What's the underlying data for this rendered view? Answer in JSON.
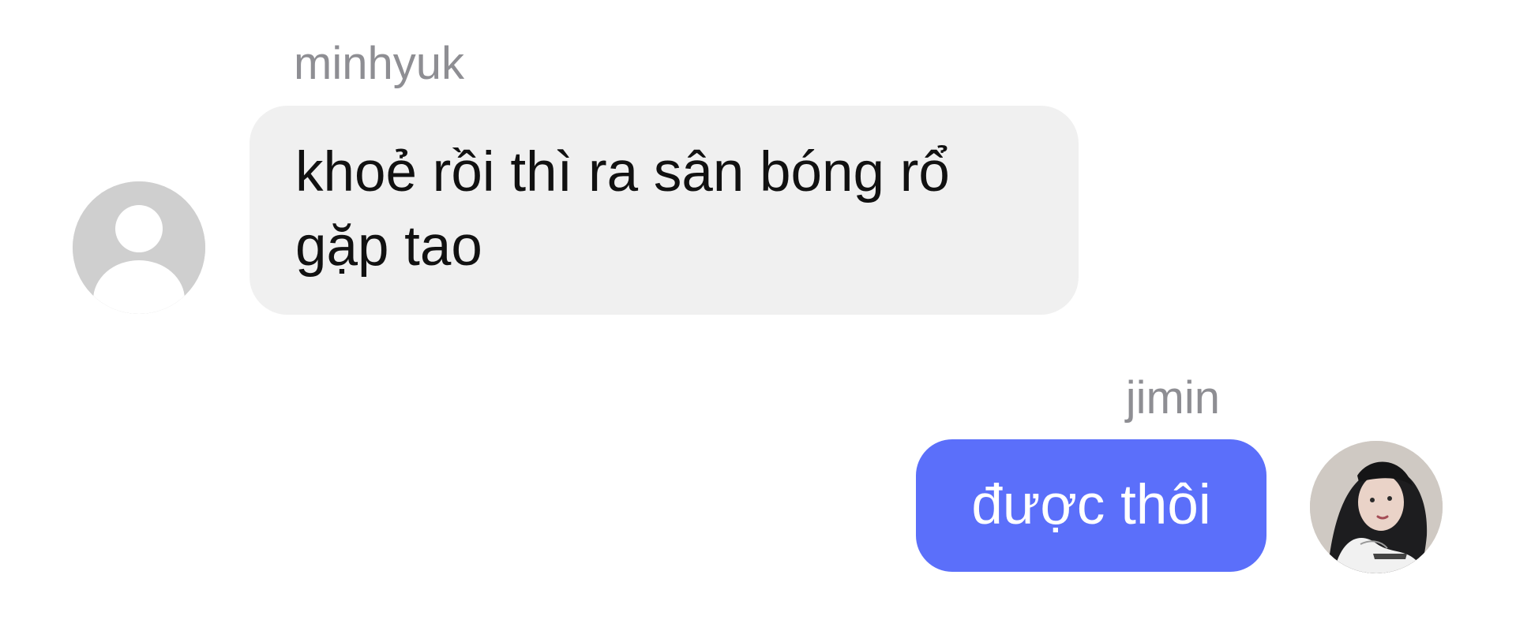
{
  "messages": [
    {
      "sender": "minhyuk",
      "text": "khoẻ rồi thì ra sân bóng rổ gặp tao",
      "direction": "incoming",
      "avatar": "default-person-icon",
      "bubble_color": "#f0f0f0"
    },
    {
      "sender": "jimin",
      "text": "được thôi",
      "direction": "outgoing",
      "avatar": "user-photo",
      "bubble_color": "#5b6ffa"
    }
  ],
  "colors": {
    "name_text": "#8e8e93",
    "incoming_text": "#111111",
    "outgoing_text": "#ffffff",
    "placeholder_avatar": "#cfcfcf"
  }
}
